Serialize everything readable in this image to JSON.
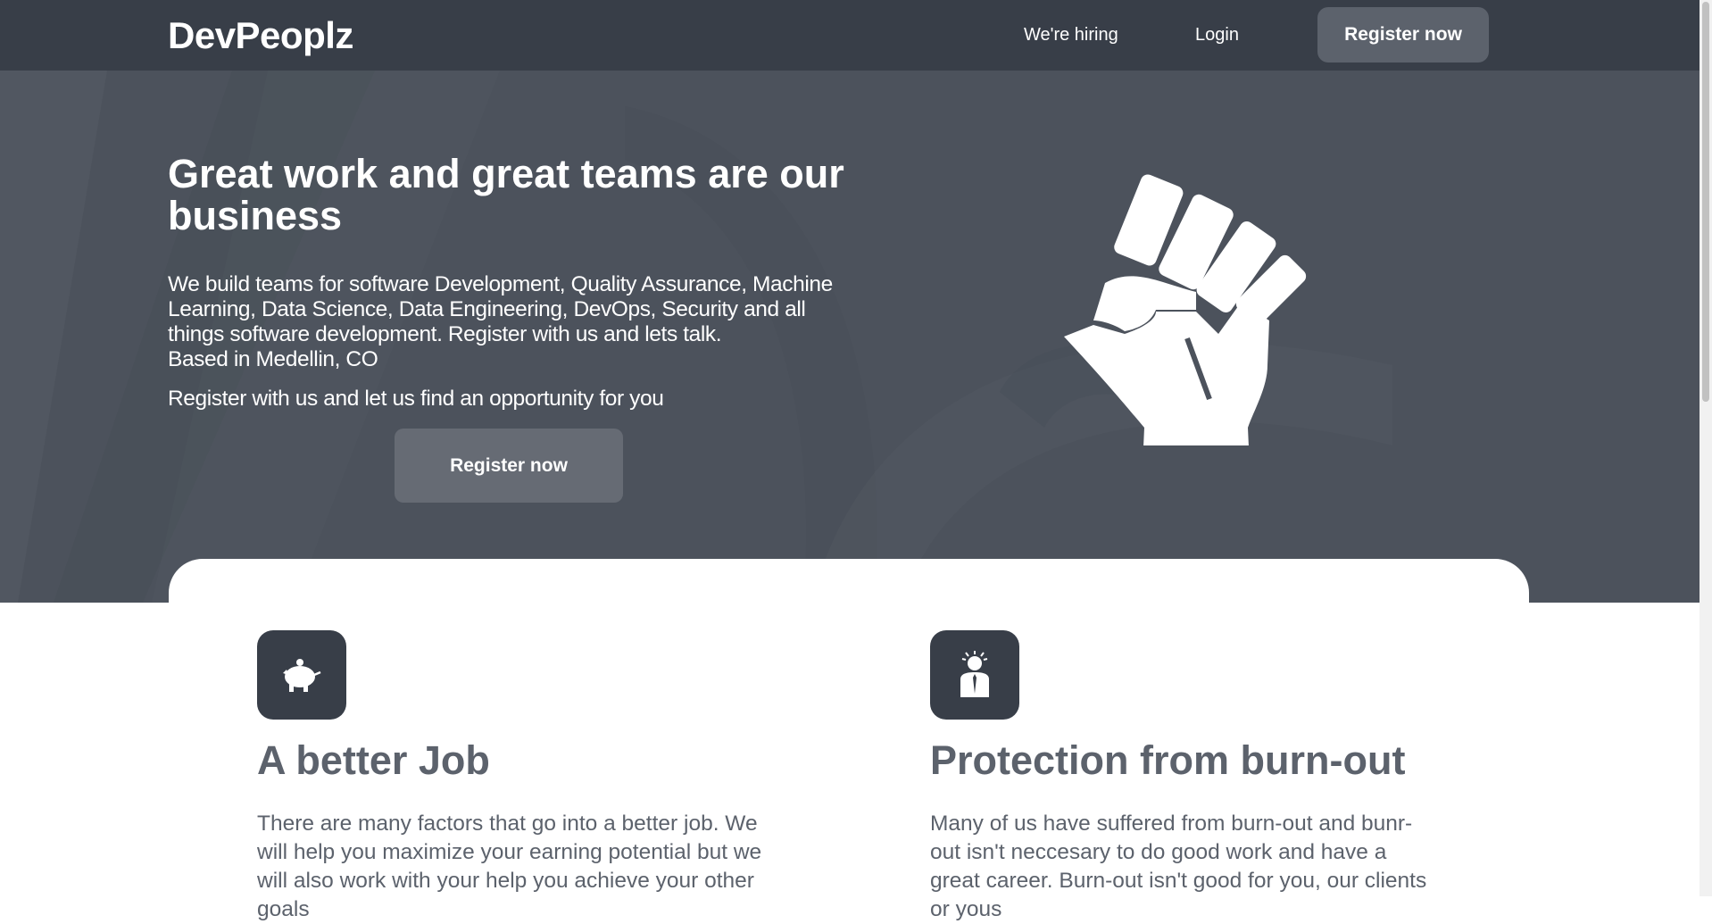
{
  "nav": {
    "logo": "DevPeoplz",
    "links": [
      "We're hiring",
      "Login"
    ],
    "register_label": "Register now"
  },
  "hero": {
    "title": "Great work and great teams are our business",
    "description": "We build teams for software Development, Quality Assurance, Machine Learning, Data Science, Data Engineering, DevOps, Security and all things software development. Register with us and lets talk.",
    "location": "Based in Medellin, CO",
    "cta_text": "Register with us and let us find an opportunity for you",
    "register_label": "Register now",
    "image_icon": "raised-fist-icon"
  },
  "features": [
    {
      "icon": "piggy-bank-icon",
      "title": "A better Job",
      "text": "There are many factors that go into a better job. We will help you maximize your earning potential but we will also work with your help you achieve your other goals"
    },
    {
      "icon": "burned-out-person-icon",
      "title": "Protection from burn-out",
      "text": "Many of us have suffered from burn-out and bunr-out isn't neccesary to do good work and have a great career. Burn-out isn't good for you, our clients or yous"
    }
  ],
  "colors": {
    "navbar": "#383e48",
    "hero_bg": "#4c525c",
    "button": "#5c626c",
    "feature_text": "#5c626c"
  }
}
